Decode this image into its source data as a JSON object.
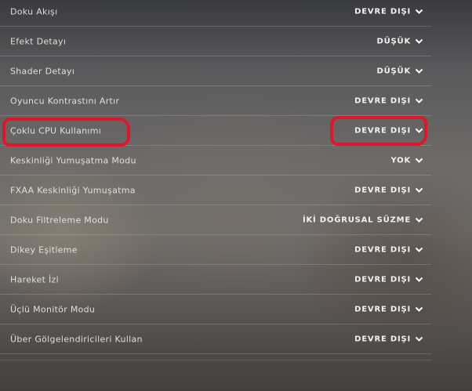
{
  "settings": [
    {
      "label": "Doku Akışı",
      "value": "DEVRE DIŞI",
      "icon": "chevron-down-icon"
    },
    {
      "label": "Efekt Detayı",
      "value": "DÜŞÜK",
      "icon": "chevron-down-icon"
    },
    {
      "label": "Shader Detayı",
      "value": "DÜŞÜK",
      "icon": "chevron-down-icon"
    },
    {
      "label": "Oyuncu Kontrastını Artır",
      "value": "DEVRE DIŞI",
      "icon": "chevron-down-icon"
    },
    {
      "label": "Çoklu CPU Kullanımı",
      "value": "DEVRE DIŞI",
      "icon": "chevron-down-icon",
      "highlighted": true
    },
    {
      "label": "Keskinliği Yumuşatma Modu",
      "value": "YOK",
      "icon": "chevron-down-icon"
    },
    {
      "label": "FXAA Keskinliği Yumuşatma",
      "value": "DEVRE DIŞI",
      "icon": "chevron-down-icon"
    },
    {
      "label": "Doku Filtreleme Modu",
      "value": "İKİ DOĞRUSAL SÜZME",
      "icon": "chevron-down-icon"
    },
    {
      "label": "Dikey Eşitleme",
      "value": "DEVRE DIŞI",
      "icon": "chevron-down-icon"
    },
    {
      "label": "Hareket İzi",
      "value": "DEVRE DIŞI",
      "icon": "chevron-down-icon"
    },
    {
      "label": "Üçlü Monitör Modu",
      "value": "DEVRE DIŞI",
      "icon": "chevron-down-icon"
    },
    {
      "label": "Über Gölgelendiricileri Kullan",
      "value": "DEVRE DIŞI",
      "icon": "chevron-down-icon"
    }
  ],
  "colors": {
    "highlight_mark": "#e0142a",
    "label_text": "#e9e9e9",
    "value_text": "#f2f2f2"
  }
}
